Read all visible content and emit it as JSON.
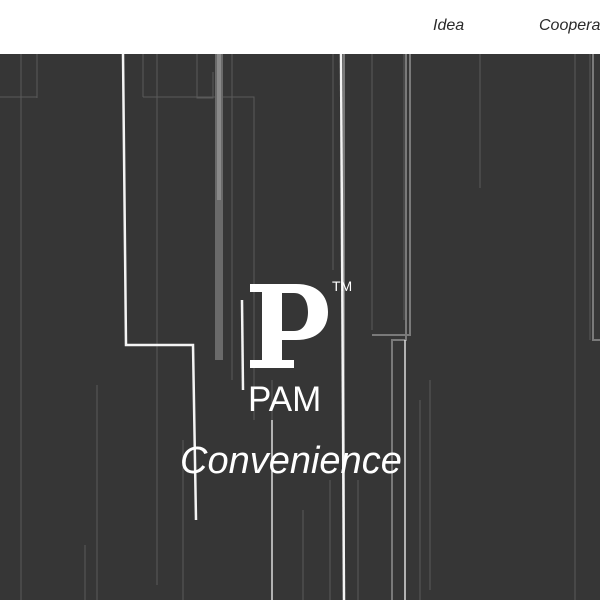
{
  "nav": {
    "items": [
      {
        "label": "Idea"
      },
      {
        "label": "Cooperation"
      }
    ]
  },
  "hero": {
    "logo_letter": "P",
    "trademark": "TM",
    "brand_name": "PAM",
    "tagline": "Convenience"
  },
  "colors": {
    "hero_background": "#363636",
    "topbar_background": "#ffffff",
    "text_light": "#ffffff",
    "nav_text": "#2b2b2b"
  }
}
